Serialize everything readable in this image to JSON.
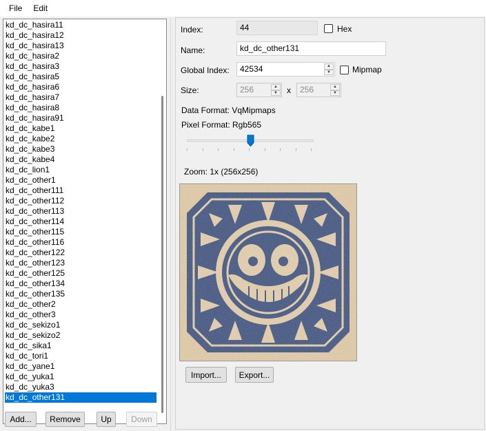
{
  "menu": {
    "file": "File",
    "edit": "Edit"
  },
  "texture_list": {
    "items": [
      "kd_dc_hasira11",
      "kd_dc_hasira12",
      "kd_dc_hasira13",
      "kd_dc_hasira2",
      "kd_dc_hasira3",
      "kd_dc_hasira5",
      "kd_dc_hasira6",
      "kd_dc_hasira7",
      "kd_dc_hasira8",
      "kd_dc_hasira91",
      "kd_dc_kabe1",
      "kd_dc_kabe2",
      "kd_dc_kabe3",
      "kd_dc_kabe4",
      "kd_dc_lion1",
      "kd_dc_other1",
      "kd_dc_other111",
      "kd_dc_other112",
      "kd_dc_other113",
      "kd_dc_other114",
      "kd_dc_other115",
      "kd_dc_other116",
      "kd_dc_other122",
      "kd_dc_other123",
      "kd_dc_other125",
      "kd_dc_other134",
      "kd_dc_other135",
      "kd_dc_other2",
      "kd_dc_other3",
      "kd_dc_sekizo1",
      "kd_dc_sekizo2",
      "kd_dc_sika1",
      "kd_dc_tori1",
      "kd_dc_yane1",
      "kd_dc_yuka1",
      "kd_dc_yuka3",
      "kd_dc_other131"
    ],
    "selected_index": 36
  },
  "list_buttons": {
    "add": "Add...",
    "remove": "Remove",
    "up": "Up",
    "down": "Down"
  },
  "properties": {
    "index_label": "Index:",
    "index_value": "44",
    "hex_label": "Hex",
    "name_label": "Name:",
    "name_value": "kd_dc_other131",
    "global_index_label": "Global Index:",
    "global_index_value": "42534",
    "mipmap_label": "Mipmap",
    "size_label": "Size:",
    "width_value": "256",
    "x_label": "x",
    "height_value": "256",
    "data_format": "Data Format: VqMipmaps",
    "pixel_format": "Pixel Format: Rgb565",
    "zoom_label": "Zoom: 1x (256x256)",
    "zoom_slider_value": 0.5
  },
  "preview_buttons": {
    "import": "Import...",
    "export": "Export..."
  },
  "colors": {
    "selection": "#0078d7",
    "tile_blue": "#2d4f8f",
    "tile_cream": "#e9dcc2",
    "tile_rust": "#a8632f"
  },
  "icons": {
    "spin_up": "▲",
    "spin_down": "▼"
  }
}
